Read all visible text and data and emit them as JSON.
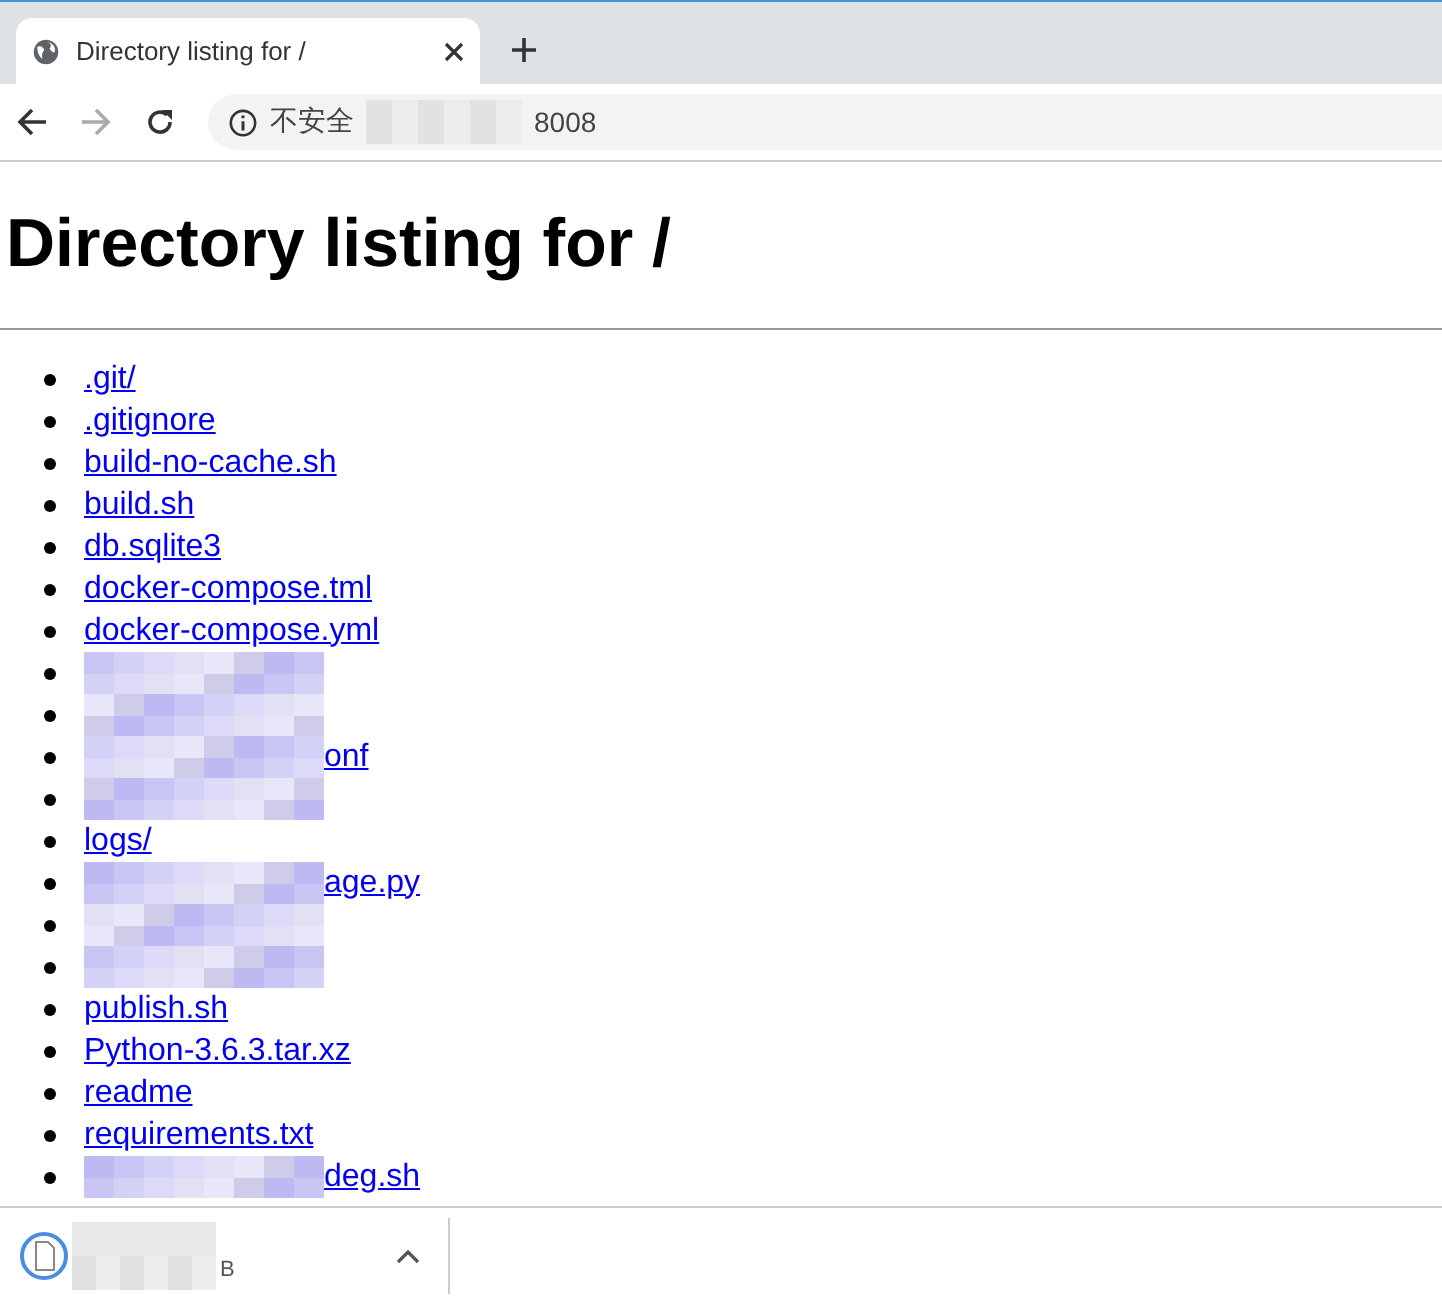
{
  "browser": {
    "tab": {
      "title": "Directory listing for /",
      "selected": true
    },
    "address": {
      "security": "不安全",
      "url": "8008"
    }
  },
  "page": {
    "heading": "Directory listing for /",
    "items": [
      {
        "text": ".git/",
        "redacted": false
      },
      {
        "text": ".gitignore",
        "redacted": false
      },
      {
        "text": "build-no-cache.sh",
        "redacted": false
      },
      {
        "text": "build.sh",
        "redacted": false
      },
      {
        "text": "db.sqlite3",
        "redacted": false
      },
      {
        "text": "docker-compose.tml",
        "redacted": false
      },
      {
        "text": "docker-compose.yml",
        "redacted": false
      },
      {
        "redacted": true
      },
      {
        "redacted": true
      },
      {
        "text": "onf",
        "redacted": true
      },
      {
        "redacted": true
      },
      {
        "text": "logs/",
        "redacted": false
      },
      {
        "text": "age.py",
        "redacted": true
      },
      {
        "redacted": true
      },
      {
        "redacted": true
      },
      {
        "text": "publish.sh",
        "redacted": false
      },
      {
        "text": "Python-3.6.3.tar.xz",
        "redacted": false
      },
      {
        "text": "readme",
        "redacted": false
      },
      {
        "text": "requirements.txt",
        "redacted": false
      },
      {
        "text": "deg.sh",
        "redacted": true
      }
    ]
  },
  "download_bar": {
    "size": "B"
  }
}
